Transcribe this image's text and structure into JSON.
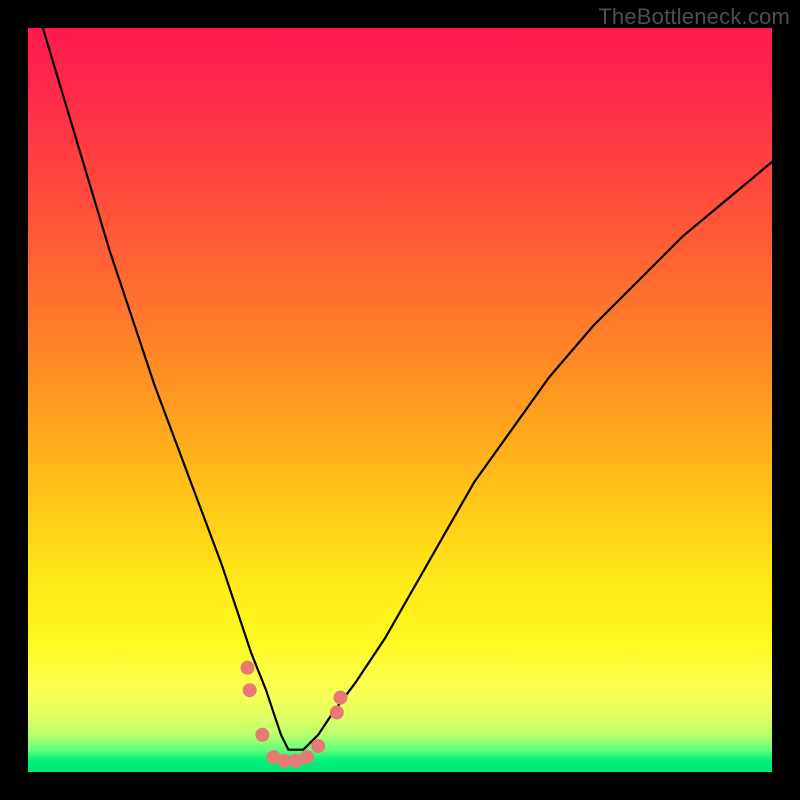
{
  "watermark": "TheBottleneck.com",
  "colors": {
    "frame_bg": "#000000",
    "gradient_top": "#ff1a4d",
    "gradient_mid1": "#ff9a20",
    "gradient_mid2": "#fff820",
    "gradient_bottom": "#00e874",
    "curve_stroke": "#000000",
    "dot_fill": "#e77a74"
  },
  "chart_data": {
    "type": "line",
    "title": "",
    "xlabel": "",
    "ylabel": "",
    "xlim": [
      0,
      100
    ],
    "ylim": [
      0,
      100
    ],
    "grid": false,
    "legend": false,
    "series": [
      {
        "name": "bottleneck-curve",
        "x": [
          2,
          5,
          8,
          11,
          14,
          17,
          20,
          23,
          26,
          28,
          30,
          32,
          33,
          34,
          35,
          36,
          37,
          39,
          41,
          44,
          48,
          52,
          56,
          60,
          65,
          70,
          76,
          82,
          88,
          94,
          100
        ],
        "y": [
          100,
          90,
          80,
          70,
          61,
          52,
          44,
          36,
          28,
          22,
          16,
          11,
          8,
          5,
          3,
          3,
          3,
          5,
          8,
          12,
          18,
          25,
          32,
          39,
          46,
          53,
          60,
          66,
          72,
          77,
          82
        ]
      }
    ],
    "dots": {
      "name": "marker-dots",
      "points": [
        {
          "x": 29.5,
          "y": 14
        },
        {
          "x": 29.8,
          "y": 11
        },
        {
          "x": 31.5,
          "y": 5
        },
        {
          "x": 33,
          "y": 2
        },
        {
          "x": 34.5,
          "y": 1.5
        },
        {
          "x": 36,
          "y": 1.5
        },
        {
          "x": 37.5,
          "y": 2
        },
        {
          "x": 39,
          "y": 3.5
        },
        {
          "x": 41.5,
          "y": 8
        },
        {
          "x": 42,
          "y": 10
        }
      ]
    },
    "notes": "V-shaped bottleneck curve over rainbow gradient. Minimum (~3%) near x≈35. Left branch rises to 100% at x≈2; right branch rises to ~82% at x=100. y-axis inverted visually (0 at bottom → green, 100 at top → red)."
  }
}
